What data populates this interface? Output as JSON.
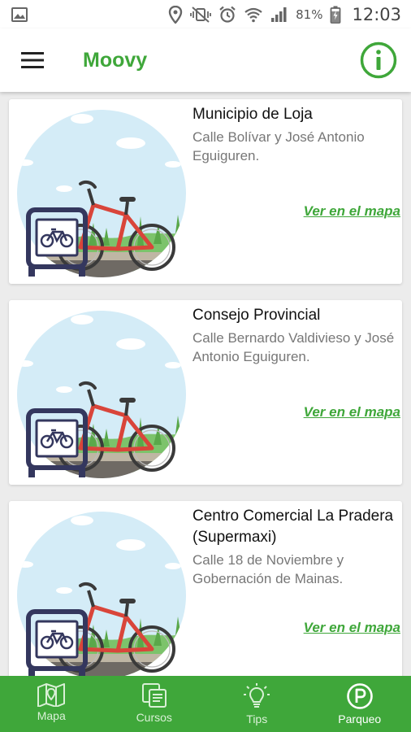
{
  "status_bar": {
    "battery": "81%",
    "time": "12:03"
  },
  "app_bar": {
    "title": "Moovy"
  },
  "parkings": [
    {
      "name": "Municipio de Loja",
      "address": "Calle Bolívar y José Antonio Eguiguren.",
      "link": "Ver en el mapa"
    },
    {
      "name": "Consejo Provincial",
      "address": "Calle Bernardo Valdivieso y José Antonio Eguiguren.",
      "link": "Ver en el mapa"
    },
    {
      "name": "Centro Comercial La Pradera (Supermaxi)",
      "address": "Calle 18 de Noviembre y Gobernación de Mainas.",
      "link": "Ver en el mapa"
    }
  ],
  "bottom_nav": {
    "items": [
      {
        "label": "Mapa",
        "icon": "map-icon"
      },
      {
        "label": "Cursos",
        "icon": "courses-icon"
      },
      {
        "label": "Tips",
        "icon": "lightbulb-icon"
      },
      {
        "label": "Parqueo",
        "icon": "parking-icon"
      }
    ],
    "active": "Parqueo"
  },
  "colors": {
    "accent": "#3fa73a",
    "bike_frame": "#d9453a",
    "rack": "#34375e"
  }
}
